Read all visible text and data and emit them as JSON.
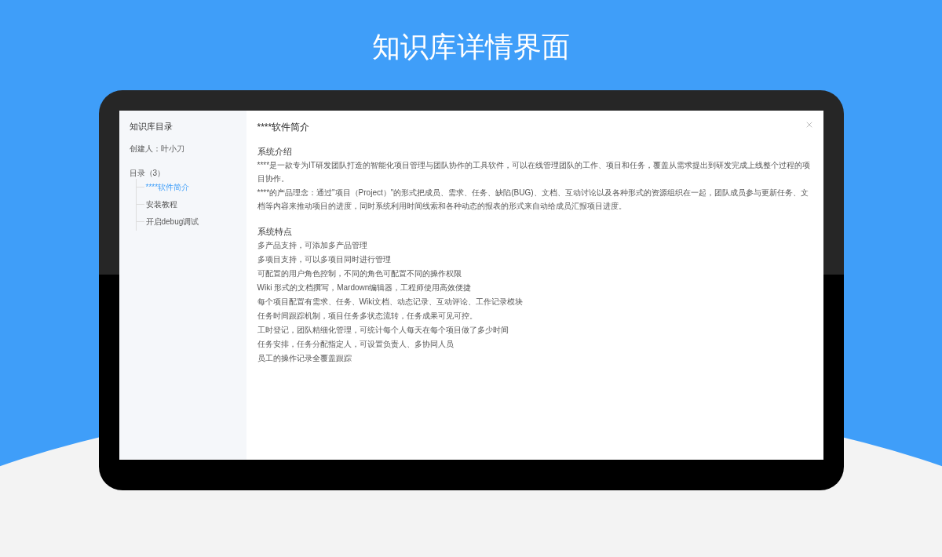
{
  "banner_title": "知识库详情界面",
  "sidebar": {
    "heading": "知识库目录",
    "creator": "创建人：叶小刀",
    "toc_label": "目录（3）",
    "items": [
      {
        "label": "****软件简介",
        "selected": true
      },
      {
        "label": "安装教程",
        "selected": false
      },
      {
        "label": "开启debug调试",
        "selected": false
      }
    ]
  },
  "document": {
    "title": "****软件简介",
    "sections": [
      {
        "heading": "系统介绍",
        "paragraphs": [
          "****是一款专为IT研发团队打造的智能化项目管理与团队协作的工具软件，可以在线管理团队的工作、项目和任务，覆盖从需求提出到研发完成上线整个过程的项目协作。",
          "****的产品理念：通过\"项目（Project）\"的形式把成员、需求、任务、缺陷(BUG)、文档、互动讨论以及各种形式的资源组织在一起，团队成员参与更新任务、文档等内容来推动项目的进度，同时系统利用时间线索和各种动态的报表的形式来自动给成员汇报项目进度。"
        ]
      },
      {
        "heading": "系统特点",
        "paragraphs": [
          "多产品支持，可添加多产品管理",
          "多项目支持，可以多项目同时进行管理",
          "可配置的用户角色控制，不同的角色可配置不同的操作权限",
          "Wiki 形式的文档撰写，Mardown编辑器，工程师使用高效便捷",
          "每个项目配置有需求、任务、Wiki文档、动态记录、互动评论、工作记录模块",
          "任务时间跟踪机制，项目任务多状态流转，任务成果可见可控。",
          "工时登记，团队精细化管理，可统计每个人每天在每个项目做了多少时间",
          "任务安排，任务分配指定人，可设置负责人、多协同人员",
          "员工的操作记录全覆盖跟踪"
        ]
      }
    ]
  }
}
